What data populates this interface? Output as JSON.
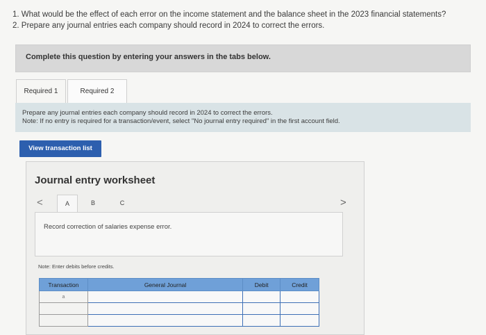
{
  "questions": [
    "1. What would be the effect of each error on the income statement and the balance sheet in the 2023 financial statements?",
    "2. Prepare any journal entries each company should record in 2024 to correct the errors."
  ],
  "banner": "Complete this question by entering your answers in the tabs below.",
  "tabs": [
    {
      "label": "Required 1"
    },
    {
      "label": "Required 2"
    }
  ],
  "instructions": {
    "line1": "Prepare any journal entries each company should record in 2024 to correct the errors.",
    "line2": "Note: If no entry is required for a transaction/event, select \"No journal entry required\" in the first account field."
  },
  "view_button": "View transaction list",
  "worksheet": {
    "title": "Journal entry worksheet",
    "prev": "<",
    "next": ">",
    "sub_tabs": [
      "A",
      "B",
      "C"
    ],
    "record_text": "Record correction of salaries expense error.",
    "note": "Note: Enter debits before credits.",
    "columns": [
      "Transaction",
      "General Journal",
      "Debit",
      "Credit"
    ],
    "rows": [
      {
        "transaction": "a",
        "account": "",
        "debit": "",
        "credit": ""
      },
      {
        "transaction": "",
        "account": "",
        "debit": "",
        "credit": ""
      },
      {
        "transaction": "",
        "account": "",
        "debit": "",
        "credit": ""
      }
    ]
  }
}
